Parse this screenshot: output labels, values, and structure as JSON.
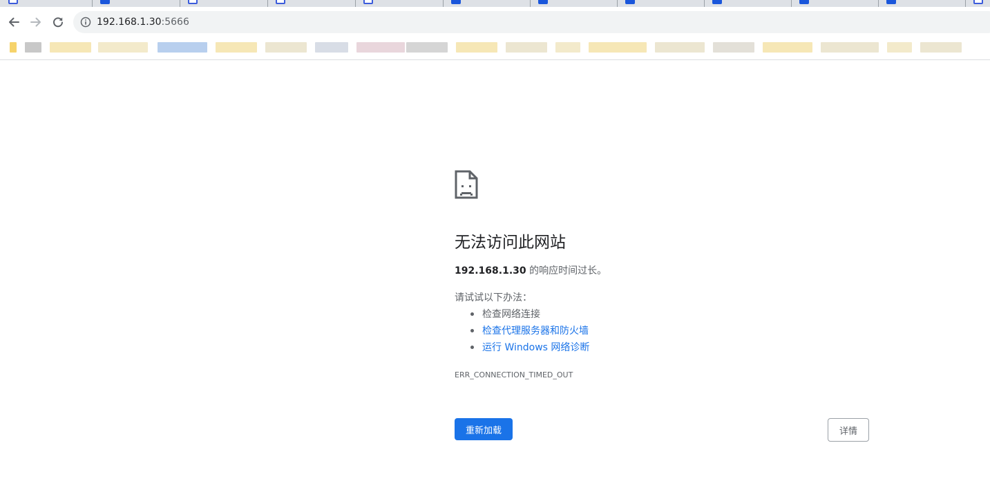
{
  "address_bar": {
    "host": "192.168.1.30",
    "port": ":5666"
  },
  "error": {
    "title": "无法访问此网站",
    "host": "192.168.1.30",
    "message": " 的响应时间过长。",
    "try_heading": "请试试以下办法：",
    "suggestions": [
      {
        "label": "检查网络连接",
        "link": false
      },
      {
        "label": "检查代理服务器和防火墙",
        "link": true
      },
      {
        "label": "运行 Windows 网络诊断",
        "link": true
      }
    ],
    "code": "ERR_CONNECTION_TIMED_OUT"
  },
  "buttons": {
    "reload": "重新加载",
    "details": "详情"
  },
  "colors": {
    "primary_blue": "#1a73e8",
    "text_secondary": "#5f6368"
  },
  "icons": [
    "back-arrow-icon",
    "forward-arrow-icon",
    "reload-icon",
    "site-info-icon",
    "sad-page-icon"
  ]
}
